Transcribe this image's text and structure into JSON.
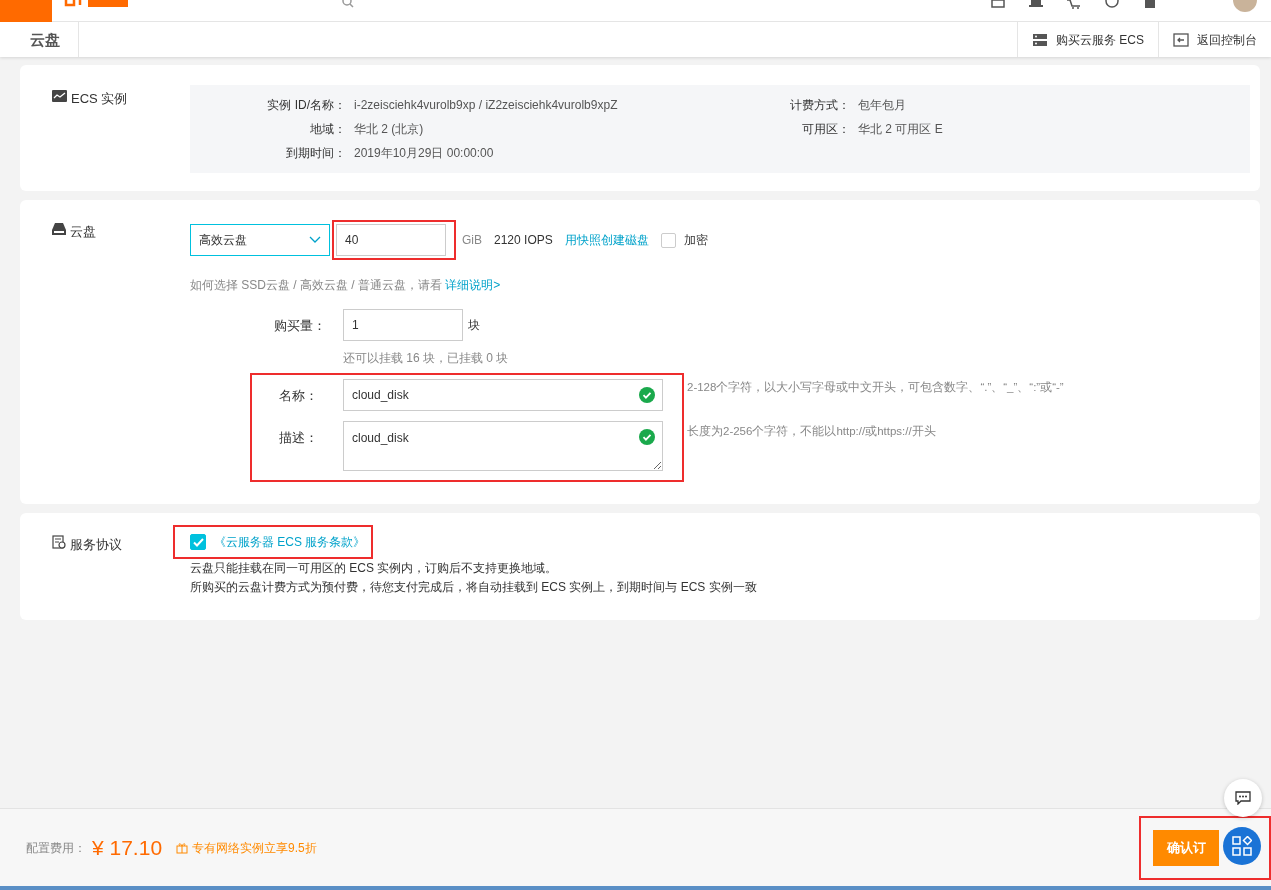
{
  "subheader": {
    "title": "云盘",
    "links": [
      {
        "kind": "buy",
        "label": "购买云服务 ECS"
      },
      {
        "kind": "back",
        "label": "返回控制台"
      }
    ]
  },
  "instance": {
    "title": "ECS 实例",
    "left": [
      {
        "label": "实例 ID/名称：",
        "value": "i-2zeisciehk4vurolb9xp / iZ2zeisciehk4vurolb9xpZ"
      },
      {
        "label": "地域：",
        "value": "华北 2 (北京)"
      },
      {
        "label": "到期时间：",
        "value": "2019年10月29日 00:00:00"
      }
    ],
    "right": [
      {
        "label": "计费方式：",
        "value": "包年包月"
      },
      {
        "label": "可用区：",
        "value": "华北 2 可用区 E"
      }
    ]
  },
  "disk": {
    "title": "云盘",
    "type": "高效云盘",
    "size": {
      "value": "40",
      "highlighted": true
    },
    "unit": "GiB",
    "iops": "2120 IOPS",
    "snapshot_link": "用快照创建磁盘",
    "encrypt": {
      "label": "加密",
      "checked": false
    },
    "hint": "如何选择 SSD云盘 / 高效云盘 / 普通云盘，请看",
    "hint_link": "详细说明>",
    "quantity": {
      "label": "购买量：",
      "value": "1",
      "unit": "块",
      "hint": "还可以挂载 16 块，已挂载 0 块"
    },
    "naming": {
      "highlighted": true,
      "fields": [
        {
          "kind": "input",
          "label": "名称：",
          "value": "cloud_disk",
          "valid": true,
          "tip": "2-128个字符，以大小写字母或中文开头，可包含数字、“.”、“_”、“:”或“-”"
        },
        {
          "kind": "textarea",
          "label": "描述：",
          "value": "cloud_disk",
          "valid": true,
          "tip": "长度为2-256个字符，不能以http://或https://开头"
        }
      ]
    }
  },
  "agreement": {
    "title": "服务协议",
    "checked": true,
    "highlighted": true,
    "link": "《云服务器 ECS 服务条款》",
    "notes": [
      "云盘只能挂载在同一可用区的 ECS 实例内，订购后不支持更换地域。",
      "所购买的云盘计费方式为预付费，待您支付完成后，将自动挂载到 ECS 实例上，到期时间与 ECS 实例一致"
    ]
  },
  "footer": {
    "label": "配置费用：",
    "currency": "¥",
    "price": "17.10",
    "promo": "专有网络实例立享9.5折",
    "button": "确认订",
    "highlighted": true
  }
}
